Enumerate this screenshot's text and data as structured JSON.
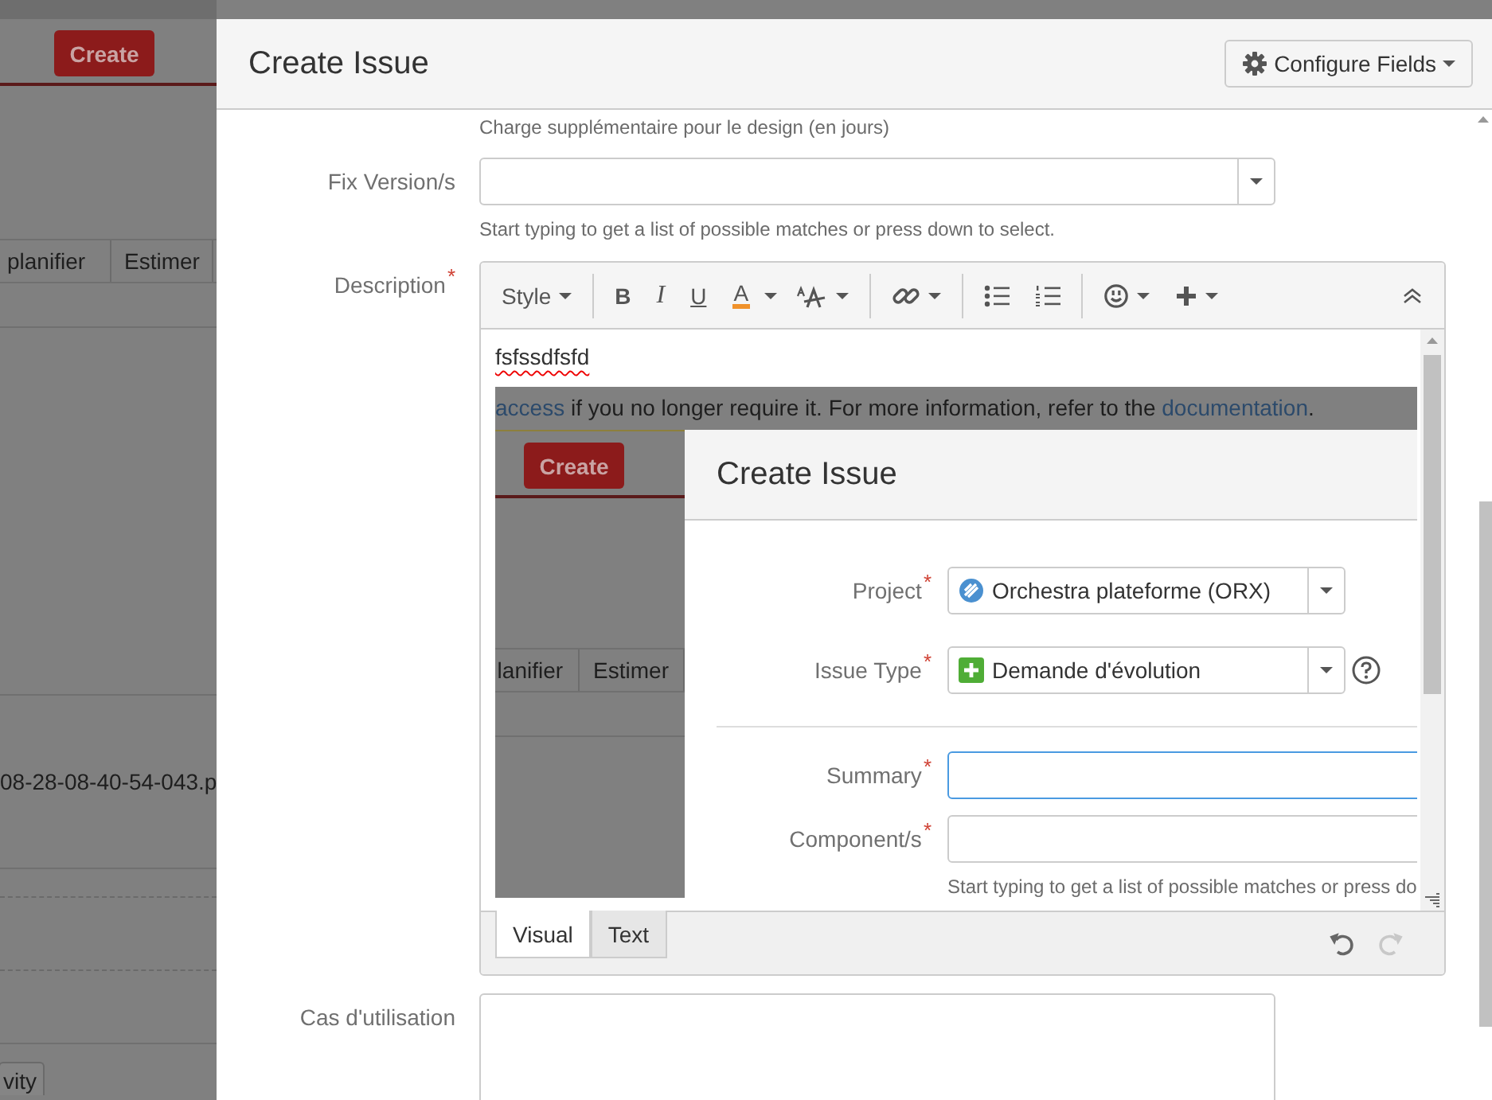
{
  "background_page": {
    "create_button": "Create",
    "tabs": [
      {
        "label": "planifier"
      },
      {
        "label": "Estimer"
      }
    ],
    "attachment_name": "08-28-08-40-54-043.p",
    "activity_button": "vity"
  },
  "required_marker": "*",
  "dialog": {
    "title": "Create Issue",
    "configure_button": "Configure Fields",
    "fields": [
      {
        "kind": "hint",
        "text": "Charge supplémentaire pour le design (en jours)"
      },
      {
        "kind": "select",
        "label": "Fix Version/s",
        "required": false,
        "hint": "Start typing to get a list of possible matches or press down to select."
      },
      {
        "kind": "editor",
        "label": "Description",
        "required": true,
        "toolbar": [
          [
            {
              "kind": "text",
              "label": "Style",
              "dropdown": true
            }
          ],
          [
            {
              "kind": "text",
              "label": "B",
              "dropdown": false
            },
            {
              "kind": "text",
              "label": "I",
              "dropdown": false
            },
            {
              "kind": "text",
              "label": "U",
              "dropdown": false
            },
            {
              "kind": "text",
              "label": "A",
              "dropdown": true
            },
            {
              "kind": "icon",
              "dropdown": true
            }
          ],
          [
            {
              "kind": "icon",
              "dropdown": true
            }
          ],
          [
            {
              "kind": "icon",
              "dropdown": false
            },
            {
              "kind": "icon",
              "dropdown": false
            }
          ],
          [
            {
              "kind": "icon",
              "dropdown": true
            },
            {
              "kind": "icon",
              "dropdown": true
            }
          ]
        ],
        "toolbar_right": [
          {
            "kind": "icon",
            "dropdown": false
          }
        ],
        "content": "fsfssdfsfd",
        "misspelled": true,
        "pasted_screenshot": {
          "banner": [
            {
              "text": "access",
              "link": true
            },
            {
              "text": " if you no longer require it. For more information, refer to the ",
              "link": false
            },
            {
              "text": "documentation",
              "link": true
            },
            {
              "text": ".",
              "link": false
            }
          ],
          "create_button": "Create",
          "tabs": [
            {
              "label": "lanifier"
            },
            {
              "label": "Estimer"
            }
          ],
          "dialog": {
            "title": "Create Issue",
            "fields": [
              {
                "kind": "select",
                "label": "Project",
                "required": true,
                "value": "Orchestra plateforme (ORX)",
                "help": false
              },
              {
                "kind": "select",
                "label": "Issue Type",
                "required": true,
                "value": "Demande d'évolution",
                "help": true
              },
              {
                "kind": "divider"
              },
              {
                "kind": "input",
                "label": "Summary",
                "required": true,
                "focused": true
              },
              {
                "kind": "input",
                "label": "Component/s",
                "required": true,
                "focused": false,
                "hint": "Start typing to get a list of possible matches or press do"
              }
            ]
          }
        },
        "mode_tabs": [
          {
            "label": "Visual",
            "selected": true
          },
          {
            "label": "Text",
            "selected": false
          }
        ],
        "history": [
          {
            "disabled": false
          },
          {
            "disabled": true
          }
        ]
      },
      {
        "kind": "textarea",
        "label": "Cas d'utilisation",
        "required": false
      }
    ]
  }
}
